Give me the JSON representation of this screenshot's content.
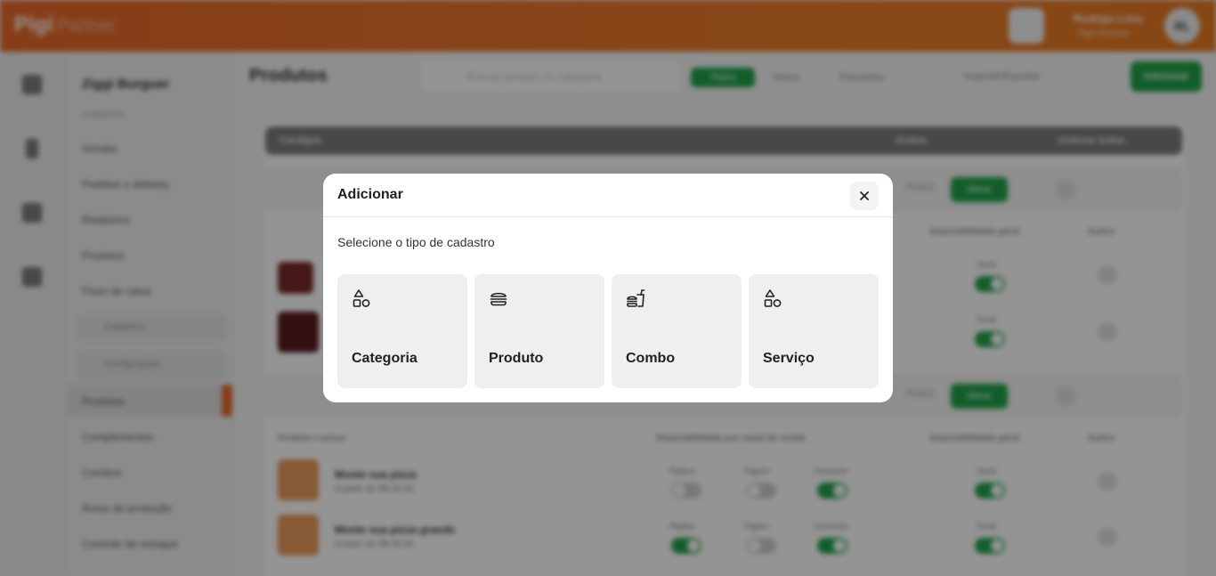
{
  "header": {
    "logo": "Pigi",
    "logo_sub": "Partner",
    "user_name": "Rodrigo Lima",
    "user_sub": "Ziggi Burguer",
    "avatar_initials": "RL"
  },
  "sidebar": {
    "store_name": "Ziggi Burguer",
    "section": "Cardápio",
    "items": [
      "Vendas",
      "Pedidos e delivery",
      "Relatórios",
      "Produtos",
      "Fluxo de caixa"
    ],
    "groups": [
      "Cadastros",
      "Configurações"
    ],
    "sub_items": [
      "Produtos",
      "Complementos",
      "Combos",
      "Áreas de produção",
      "Controle de estoque"
    ]
  },
  "content": {
    "page_title": "Produtos",
    "search_placeholder": "Buscar produto ou categoria",
    "filters": [
      "Todos",
      "Ativos",
      "Pausados"
    ],
    "import_export": "Importar/Exportar",
    "add_button": "Adicionar",
    "table_head": {
      "left": "Cardápio",
      "mid": "Ordem",
      "right": "Ordenar todos"
    },
    "col_headers": [
      "Disponibilidade geral",
      "Ações",
      "Produto e preço",
      "Disponibilidade por canal de venda"
    ],
    "pause_label": "Pausar",
    "active_label": "Ativar",
    "channel_labels": [
      "Pigibox",
      "Pigipro",
      "Consumo"
    ],
    "general_label": "Geral",
    "products": [
      {
        "name": "Monte sua pizza",
        "price": "A partir de R$ 30,00"
      },
      {
        "name": "Monte sua pizza grande",
        "price": "A partir de R$ 30,00"
      }
    ]
  },
  "modal": {
    "title": "Adicionar",
    "subtitle": "Selecione o tipo de cadastro",
    "options": [
      {
        "label": "Categoria",
        "icon": "shapes-icon"
      },
      {
        "label": "Produto",
        "icon": "burger-icon"
      },
      {
        "label": "Combo",
        "icon": "fast-food-icon"
      },
      {
        "label": "Serviço",
        "icon": "shapes-icon"
      }
    ]
  },
  "colors": {
    "brand_orange": "#e8692a",
    "accent_green": "#1fa34a"
  }
}
